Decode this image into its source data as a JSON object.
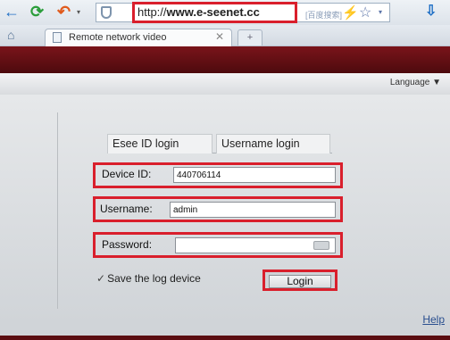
{
  "browser": {
    "url_prefix": "http://",
    "url_domain": "www.e-seenet.cc",
    "addr_hint": "[百度搜索]",
    "tab_title": "Remote network video",
    "tab_close": "✕",
    "new_tab": "+"
  },
  "icons": {
    "back": "←",
    "refresh": "⟳",
    "undo": "↶",
    "caret": "▾",
    "bolt": "⚡",
    "star": "☆",
    "drop": "▾",
    "download": "⇩",
    "home": "⌂",
    "check": "✓"
  },
  "header": {
    "language_label": "Language ▼"
  },
  "login": {
    "tabs": [
      "Esee ID login",
      "Username login"
    ],
    "device_id_label": "Device ID:",
    "device_id_value": "440706114",
    "username_label": "Username:",
    "username_value": "admin",
    "password_label": "Password:",
    "password_value": "",
    "save_label": "Save the log device",
    "login_button": "Login"
  },
  "footer": {
    "help_link": "Help"
  },
  "colors": {
    "highlight": "#d91f2c",
    "banner": "#6a1116"
  }
}
